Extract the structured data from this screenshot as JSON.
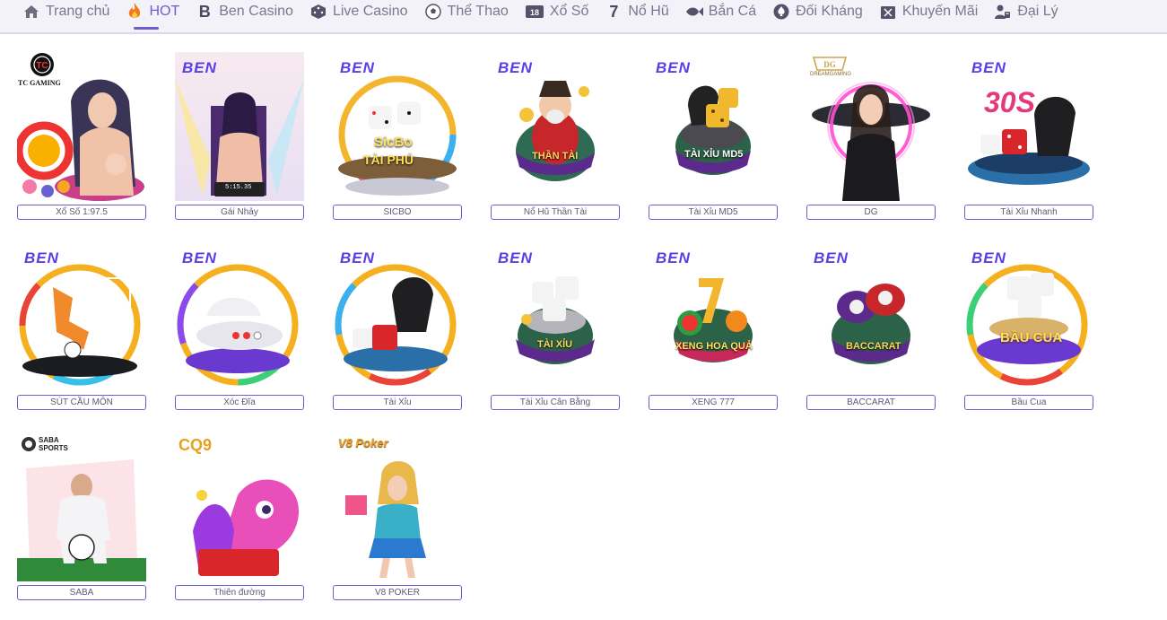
{
  "nav": {
    "items": [
      {
        "label": "Trang chủ",
        "icon": "home-icon"
      },
      {
        "label": "HOT",
        "icon": "fire-icon",
        "active": true
      },
      {
        "label": "Ben Casino",
        "icon": "ben-logo-icon"
      },
      {
        "label": "Live Casino",
        "icon": "dice-icon"
      },
      {
        "label": "Thể Thao",
        "icon": "soccer-ball-icon"
      },
      {
        "label": "Xổ Số",
        "icon": "lottery-icon"
      },
      {
        "label": "Nổ Hũ",
        "icon": "slot-seven-icon"
      },
      {
        "label": "Bắn Cá",
        "icon": "fish-icon"
      },
      {
        "label": "Đối Kháng",
        "icon": "spade-icon"
      },
      {
        "label": "Khuyến Mãi",
        "icon": "gift-icon"
      },
      {
        "label": "Đại Lý",
        "icon": "agent-icon"
      }
    ]
  },
  "games": [
    {
      "label": "Xổ Số 1:97.5",
      "provider": "TC GAMING",
      "art": "lottery-girl"
    },
    {
      "label": "Gái Nhảy",
      "provider": "BEN",
      "art": "dancer",
      "screen": "5:15.35"
    },
    {
      "label": "SICBO",
      "provider": "BEN",
      "art": "sicbo",
      "title": "SicBo",
      "subtitle": "TÀI PHÚ"
    },
    {
      "label": "Nổ Hũ Thần Tài",
      "provider": "BEN",
      "art": "god",
      "title": "THẦN TÀI"
    },
    {
      "label": "Tài Xỉu MD5",
      "provider": "BEN",
      "art": "dice-cup",
      "title": "TÀI XỈU MD5"
    },
    {
      "label": "DG",
      "provider": "DREAMGAMING",
      "art": "dealer"
    },
    {
      "label": "Tài Xỉu Nhanh",
      "provider": "BEN",
      "art": "fast-dice",
      "title": "30S"
    },
    {
      "label": "SÚT CẦU MÔN",
      "provider": "BEN",
      "art": "penalty"
    },
    {
      "label": "Xóc Đĩa",
      "provider": "BEN",
      "art": "bowl"
    },
    {
      "label": "Tài Xỉu",
      "provider": "BEN",
      "art": "dice-cup-ring"
    },
    {
      "label": "Tài Xỉu Cân Bằng",
      "provider": "BEN",
      "art": "dice-stack",
      "title": "TÀI XỈU"
    },
    {
      "label": "XENG 777",
      "provider": "BEN",
      "art": "fruit",
      "title": "XENG HOA QUẢ"
    },
    {
      "label": "BACCARAT",
      "provider": "BEN",
      "art": "chips",
      "title": "BACCARAT"
    },
    {
      "label": "Bầu Cua",
      "provider": "BEN",
      "art": "baucua",
      "title": "BẦU CUA"
    },
    {
      "label": "SABA",
      "provider": "SABA SPORTS",
      "art": "football"
    },
    {
      "label": "Thiên đường",
      "provider": "CQ9",
      "art": "dragon"
    },
    {
      "label": "V8 POKER",
      "provider": "V8 Poker",
      "art": "poker-girl"
    }
  ],
  "colors": {
    "accent": "#6a5fd0",
    "nav_bg": "#f3f2f8",
    "text": "#7b7692"
  }
}
